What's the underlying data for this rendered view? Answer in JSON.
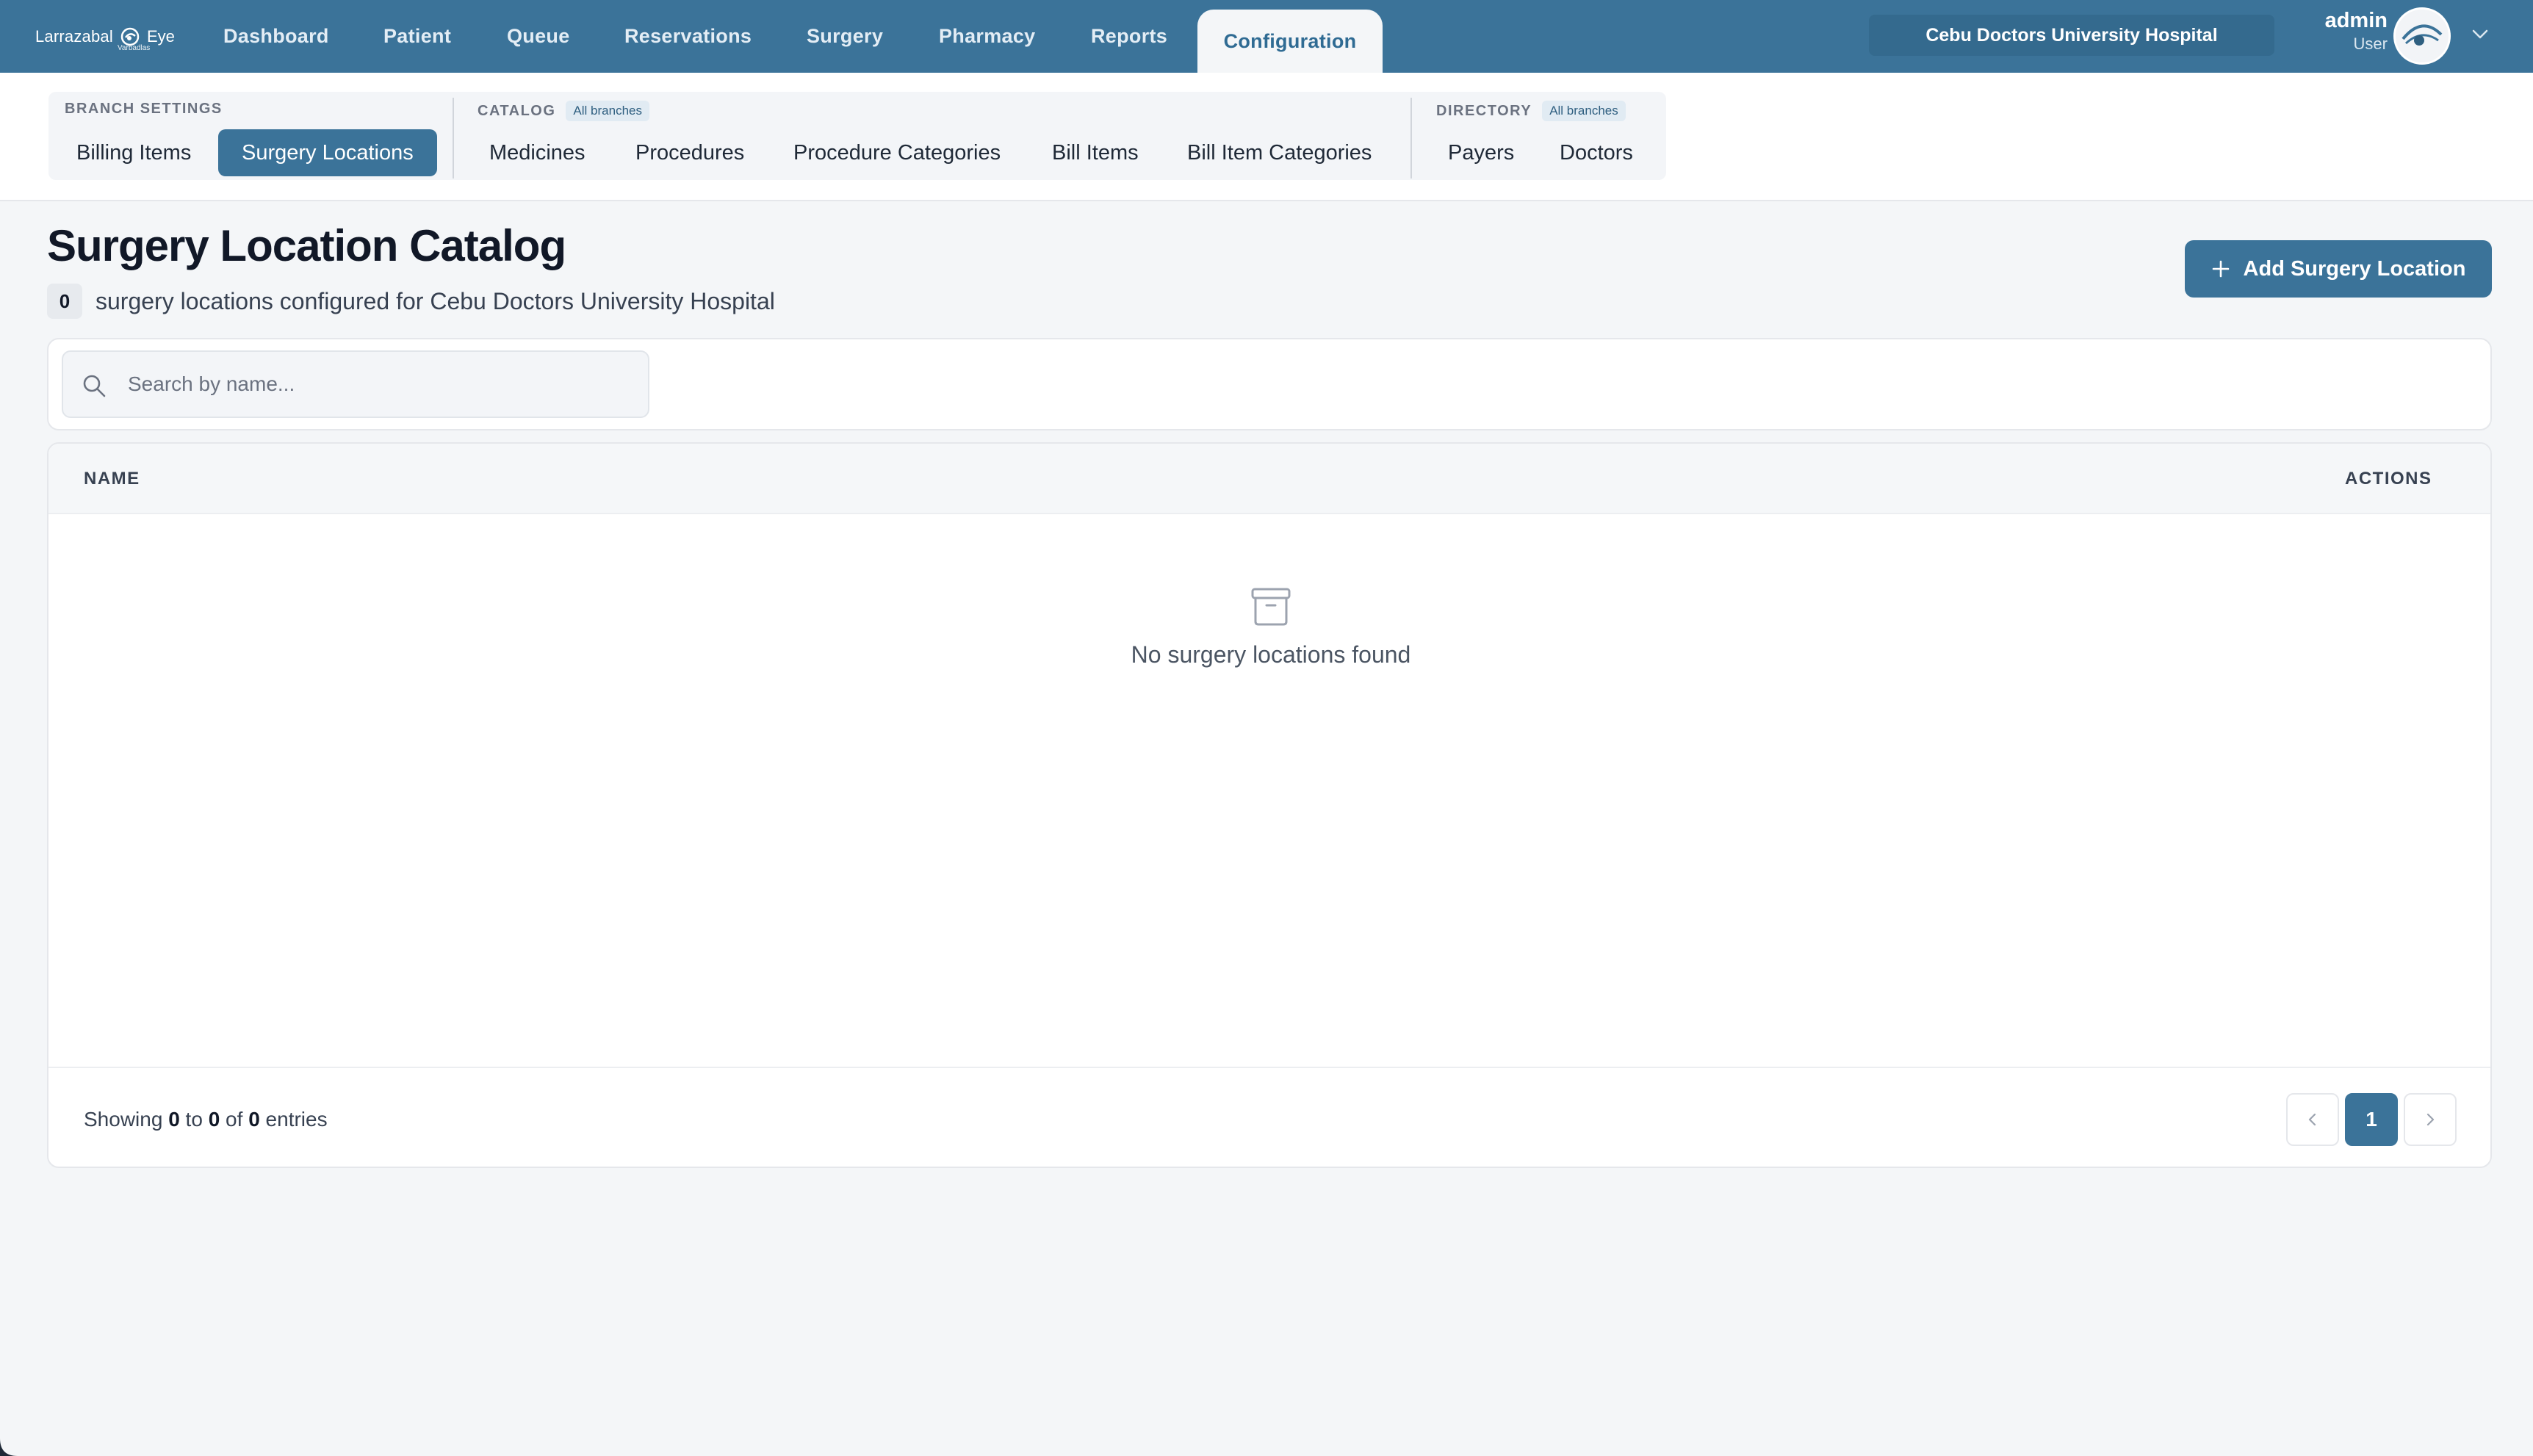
{
  "brand": {
    "name_a": "Larrazabal",
    "name_b": "Eye",
    "sub": "Varbadlas"
  },
  "nav": {
    "tabs": [
      {
        "label": "Dashboard"
      },
      {
        "label": "Patient"
      },
      {
        "label": "Queue"
      },
      {
        "label": "Reservations"
      },
      {
        "label": "Surgery"
      },
      {
        "label": "Pharmacy"
      },
      {
        "label": "Reports"
      },
      {
        "label": "Configuration",
        "active": true
      }
    ]
  },
  "header": {
    "hospital": "Cebu Doctors University Hospital",
    "user_name": "admin",
    "user_role": "User"
  },
  "subnav": {
    "branch": {
      "label": "BRANCH SETTINGS",
      "items": [
        "Billing Items",
        "Surgery Locations"
      ]
    },
    "catalog": {
      "label": "CATALOG",
      "badge": "All branches",
      "items": [
        "Medicines",
        "Procedures",
        "Procedure Categories",
        "Bill Items",
        "Bill Item Categories"
      ]
    },
    "directory": {
      "label": "DIRECTORY",
      "badge": "All branches",
      "items": [
        "Payers",
        "Doctors"
      ]
    }
  },
  "page": {
    "title": "Surgery Location Catalog",
    "count": "0",
    "count_text": "surgery locations configured for Cebu Doctors University Hospital",
    "add_label": "Add Surgery Location"
  },
  "search": {
    "placeholder": "Search by name..."
  },
  "table": {
    "columns": [
      "NAME",
      "ACTIONS"
    ],
    "empty_text": "No surgery locations found"
  },
  "pagination": {
    "showing": "Showing",
    "from": "0",
    "to_word": "to",
    "to": "0",
    "of_word": "of",
    "total": "0",
    "entries": "entries",
    "current_page": "1"
  },
  "colors": {
    "primary": "#3b7399",
    "background": "#f4f6f8"
  }
}
